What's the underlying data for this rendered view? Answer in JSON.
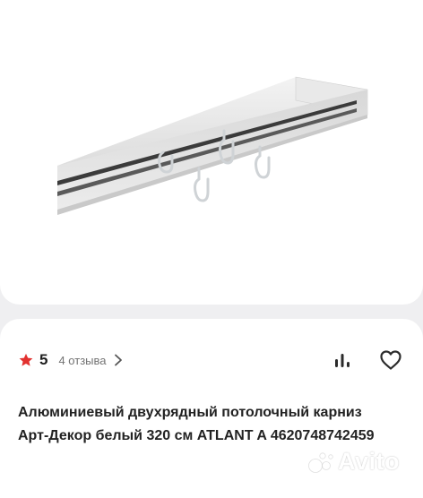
{
  "product": {
    "image_alt": "Потолочный карниз",
    "rating": "5",
    "reviews_label": "4 отзыва",
    "title": "Алюминиевый двухрядный потолочный карниз Арт-Декор белый 320 см ATLANT A 4620748742459"
  },
  "watermark": {
    "text": "Avito"
  },
  "colors": {
    "star": "#e2312f",
    "text_primary": "#222222",
    "text_secondary": "#737373",
    "background": "#efeff1"
  },
  "icons": {
    "star": "star-icon",
    "chevron": "chevron-right-icon",
    "stats": "bar-chart-icon",
    "favorite": "heart-icon"
  }
}
